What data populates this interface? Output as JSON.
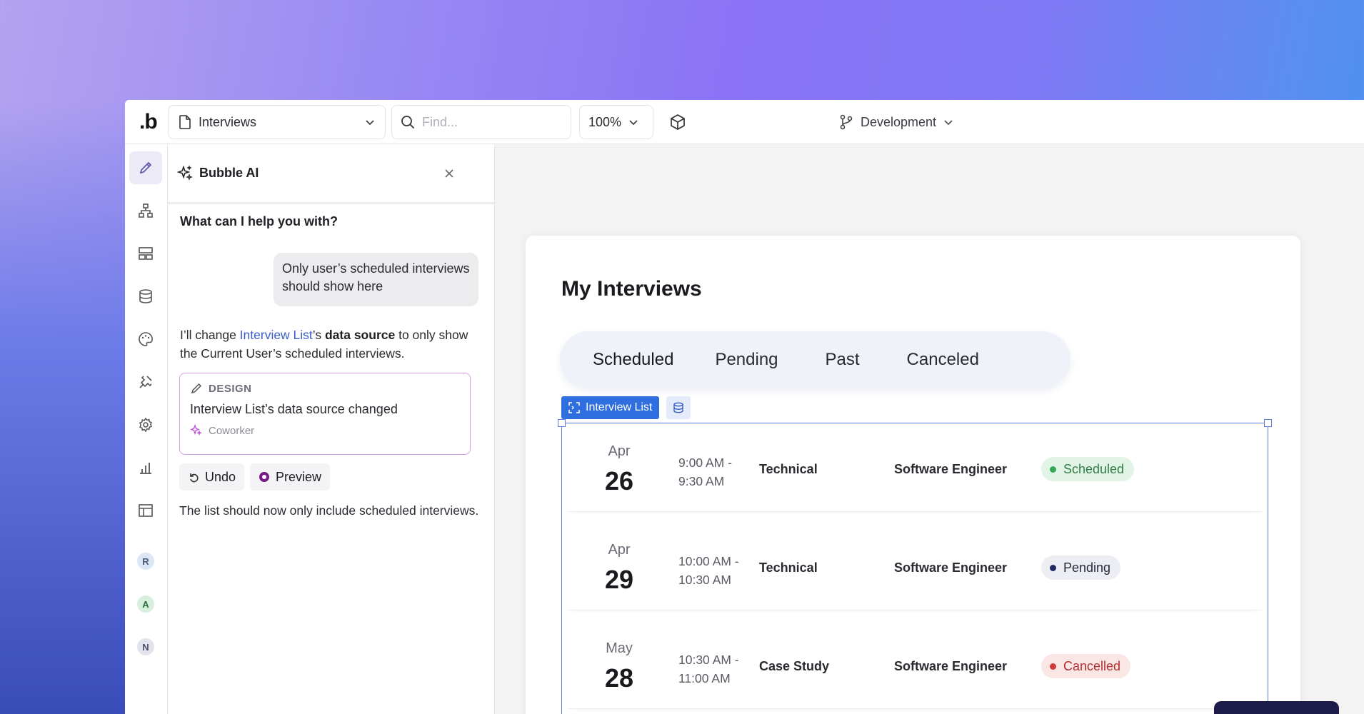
{
  "toolbar": {
    "logo": ".b",
    "page_name": "Interviews",
    "find_placeholder": "Find...",
    "zoom": "100%",
    "branch": "Development"
  },
  "sidebar": {
    "icons": [
      "pencil-icon",
      "hierarchy-icon",
      "layout-icon",
      "database-icon",
      "palette-icon",
      "plugin-icon",
      "gear-icon",
      "bar-chart-icon",
      "table-icon"
    ],
    "avatars": [
      {
        "letter": "R",
        "color": "#dbe7f5",
        "text_color": "#4a5a78"
      },
      {
        "letter": "A",
        "color": "#d8efdd",
        "text_color": "#2c6b3f"
      },
      {
        "letter": "N",
        "color": "#e3e3ee",
        "text_color": "#4d4d6a"
      }
    ]
  },
  "ai_panel": {
    "title": "Bubble AI",
    "prompt": "What can I help you with?",
    "user_message": "Only user’s scheduled interviews should show here",
    "reply_part1": "I’ll change ",
    "reply_link": "Interview List",
    "reply_part2": "’s ",
    "reply_bold": "data source",
    "reply_part3": " to only show the Current User’s scheduled interviews.",
    "change_card": {
      "category": "DESIGN",
      "description": "Interview List’s data source changed",
      "author": "Coworker"
    },
    "undo_label": "Undo",
    "preview_label": "Preview",
    "followup": "The list should now only include scheduled interviews."
  },
  "canvas": {
    "heading": "My Interviews",
    "tabs": [
      "Scheduled",
      "Pending",
      "Past",
      "Canceled"
    ],
    "active_tab": "Scheduled",
    "element_tag": "Interview List",
    "rows": [
      {
        "month": "Apr",
        "day": "26",
        "start": "9:00 AM -",
        "end": "9:30 AM",
        "type": "Technical",
        "role": "Software Engineer",
        "status": "Scheduled",
        "status_bg": "#e2f4e6",
        "status_fg": "#2f7d45",
        "dot": "#34a853"
      },
      {
        "month": "Apr",
        "day": "29",
        "start": "10:00 AM -",
        "end": "10:30 AM",
        "type": "Technical",
        "role": "Software Engineer",
        "status": "Pending",
        "status_bg": "#eceef3",
        "status_fg": "#2a2a3a",
        "dot": "#1e2a60"
      },
      {
        "month": "May",
        "day": "28",
        "start": "10:30 AM -",
        "end": "11:00 AM",
        "type": "Case Study",
        "role": "Software Engineer",
        "status": "Cancelled",
        "status_bg": "#fbe6e6",
        "status_fg": "#b03030",
        "dot": "#d23a3a"
      }
    ]
  }
}
